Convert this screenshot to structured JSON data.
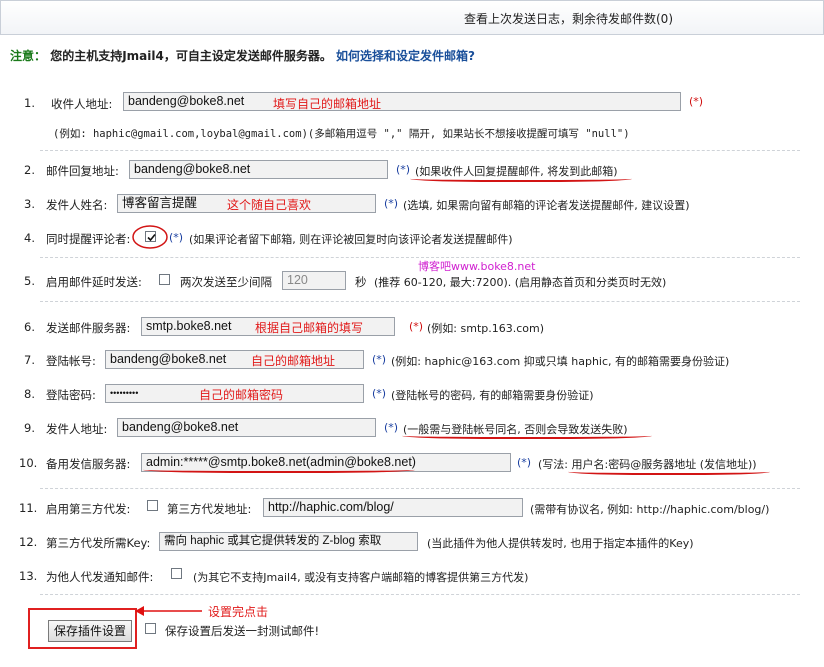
{
  "header": {
    "log_link": "查看上次发送日志，剩余待发邮件数(0)"
  },
  "notice": {
    "label": "注意：",
    "text": "您的主机支持Jmail4，可自主设定发送邮件服务器。",
    "help_link": "如何选择和设定发件邮箱?"
  },
  "fields": {
    "f1": {
      "num": "1.",
      "label": "收件人地址:",
      "value": "bandeng@boke8.net",
      "required": "(*)",
      "hint": "(例如: haphic@gmail.com,loybal@gmail.com)(多邮箱用逗号 \",\" 隔开, 如果站长不想接收提醒可填写 \"null\")",
      "annotation": "填写自己的邮箱地址"
    },
    "f2": {
      "num": "2.",
      "label": "邮件回复地址:",
      "value": "bandeng@boke8.net",
      "required": "(*)",
      "hint": "(如果收件人回复提醒邮件, 将发到此邮箱)"
    },
    "f3": {
      "num": "3.",
      "label": "发件人姓名:",
      "value": "博客留言提醒",
      "required": "(*)",
      "hint": "(选填, 如果需向留有邮箱的评论者发送提醒邮件, 建议设置)",
      "annotation": "这个随自己喜欢"
    },
    "f4": {
      "num": "4.",
      "label": "同时提醒评论者:",
      "required": "(*)",
      "hint": "(如果评论者留下邮箱, 则在评论被回复时向该评论者发送提醒邮件)",
      "checked": true
    },
    "watermark": "博客吧www.boke8.net",
    "f5": {
      "num": "5.",
      "label": "启用邮件延时发送:",
      "mid": "两次发送至少间隔",
      "value": "120",
      "unit": "秒",
      "hint": "(推荐 60-120, 最大:7200). (启用静态首页和分类页时无效)"
    },
    "f6": {
      "num": "6.",
      "label": "发送邮件服务器:",
      "value": "smtp.boke8.net",
      "required": "(*)",
      "hint": "(例如: smtp.163.com)",
      "annotation": "根据自己邮箱的填写"
    },
    "f7": {
      "num": "7.",
      "label": "登陆帐号:",
      "value": "bandeng@boke8.net",
      "required": "(*)",
      "hint": "(例如: haphic@163.com 抑或只填 haphic, 有的邮箱需要身份验证)",
      "annotation": "自己的邮箱地址"
    },
    "f8": {
      "num": "8.",
      "label": "登陆密码:",
      "value": "•••••••••",
      "required": "(*)",
      "hint": "(登陆帐号的密码, 有的邮箱需要身份验证)",
      "annotation": "自己的邮箱密码"
    },
    "f9": {
      "num": "9.",
      "label": "发件人地址:",
      "value": "bandeng@boke8.net",
      "required": "(*)",
      "hint": "(一般需与登陆帐号同名, 否则会导致发送失败)"
    },
    "f10": {
      "num": "10.",
      "label": "备用发信服务器:",
      "value": "admin:*****@smtp.boke8.net(admin@boke8.net)",
      "required": "(*)",
      "hint": "(写法: 用户名:密码@服务器地址 (发信地址))"
    },
    "f11": {
      "num": "11.",
      "label": "启用第三方代发:",
      "mid": "第三方代发地址:",
      "value": "http://haphic.com/blog/",
      "hint": "(需带有协议名, 例如: http://haphic.com/blog/)"
    },
    "f12": {
      "num": "12.",
      "label": "第三方代发所需Key:",
      "value": "需向 haphic 或其它提供转发的 Z-blog 索取",
      "hint": "(当此插件为他人提供转发时, 也用于指定本插件的Key)"
    },
    "f13": {
      "num": "13.",
      "label": "为他人代发通知邮件:",
      "hint": "(为其它不支持Jmail4, 或没有支持客户端邮箱的博客提供第三方代发)"
    }
  },
  "footer": {
    "save_button": "保存插件设置",
    "test_label": "保存设置后发送一封测试邮件!",
    "annotation": "设置完点击"
  },
  "colors": {
    "annotation": "#e11a1a",
    "accent_link": "#1a4f9a",
    "notice_label": "#1a7a1a"
  }
}
